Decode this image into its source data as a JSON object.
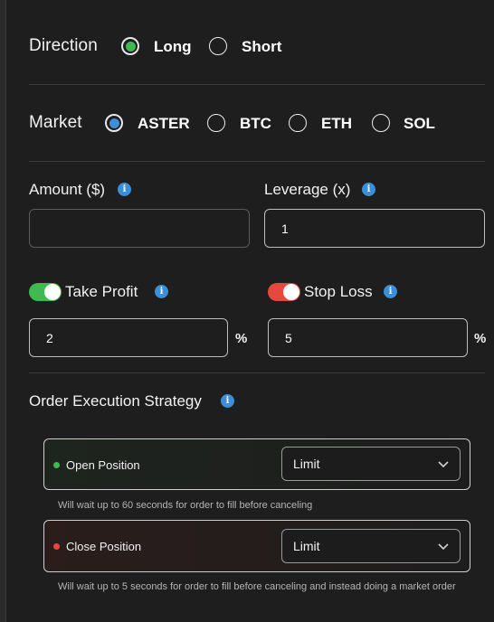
{
  "direction": {
    "label": "Direction",
    "options": [
      {
        "label": "Long",
        "selected": true,
        "color": "#3fb950"
      },
      {
        "label": "Short",
        "selected": false
      }
    ]
  },
  "market": {
    "label": "Market",
    "options": [
      {
        "label": "ASTER",
        "selected": true,
        "color": "#3b8fd9"
      },
      {
        "label": "BTC",
        "selected": false
      },
      {
        "label": "ETH",
        "selected": false
      },
      {
        "label": "SOL",
        "selected": false
      }
    ]
  },
  "amount": {
    "label": "Amount ($)",
    "value": ""
  },
  "leverage": {
    "label": "Leverage (x)",
    "value": "1"
  },
  "take_profit": {
    "label": "Take Profit",
    "enabled": true,
    "value": "2",
    "unit": "%",
    "color": "#3fb950"
  },
  "stop_loss": {
    "label": "Stop Loss",
    "enabled": true,
    "value": "5",
    "unit": "%",
    "color": "#e5483d"
  },
  "strategy": {
    "title": "Order Execution Strategy",
    "open": {
      "label": "Open Position",
      "type": "Limit",
      "dot_color": "#3fb950",
      "note": "Will wait up to 60 seconds for order to fill before canceling"
    },
    "close": {
      "label": "Close Position",
      "type": "Limit",
      "dot_color": "#e5483d",
      "note": "Will wait up to 5 seconds for order to fill before canceling and instead doing a market order"
    }
  },
  "icons": {
    "info": "info-icon",
    "chevron": "chevron-down-icon"
  }
}
